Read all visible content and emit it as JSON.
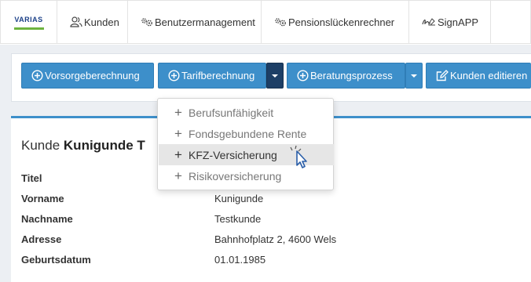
{
  "topnav": {
    "brand": "VARIAS",
    "items": [
      {
        "label": "Kunden",
        "icon": "users-icon"
      },
      {
        "label": "Benutzermanagement",
        "icon": "gears-icon"
      },
      {
        "label": "Pensionslückenrechner",
        "icon": "gears-icon"
      },
      {
        "label": "SignAPP",
        "icon": "signature-icon"
      }
    ]
  },
  "toolbar": {
    "vorsorge_label": "Vorsorgeberechnung",
    "tarif_label": "Tarifberechnung",
    "beratung_label": "Beratungsprozess",
    "kunden_label": "Kunden editieren"
  },
  "dropdown": {
    "items": [
      {
        "label": "Berufsunfähigkeit"
      },
      {
        "label": "Fondsgebundene Rente"
      },
      {
        "label": "KFZ-Versicherung",
        "active": true
      },
      {
        "label": "Risikoversicherung"
      }
    ]
  },
  "customer": {
    "title_prefix": "Kunde",
    "title_name": "Kunigunde T",
    "fields": [
      {
        "label": "Titel",
        "value": ""
      },
      {
        "label": "Vorname",
        "value": "Kunigunde"
      },
      {
        "label": "Nachname",
        "value": "Testkunde"
      },
      {
        "label": "Adresse",
        "value": "Bahnhofplatz 2, 4600 Wels"
      },
      {
        "label": "Geburtsdatum",
        "value": "01.01.1985"
      }
    ]
  },
  "colors": {
    "primary_button": "#3d8fca",
    "active_caret": "#1d3f66",
    "brand_blue": "#1a3f87",
    "brand_green": "#6db33f",
    "page_background": "#eceff3"
  }
}
